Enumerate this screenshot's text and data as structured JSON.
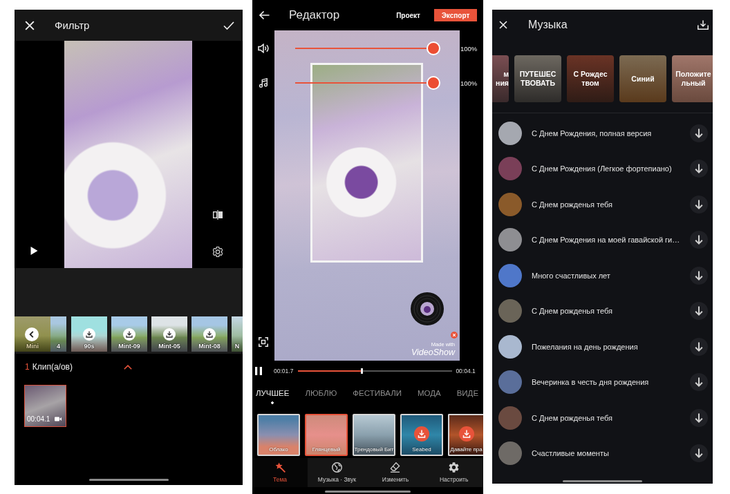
{
  "filter_screen": {
    "title": "Фильтр",
    "preview_playing": false,
    "filters": [
      {
        "label": "Mini",
        "selected": true,
        "downloadable": false
      },
      {
        "label": "4",
        "selected": false,
        "downloadable": false
      },
      {
        "label": "90s",
        "selected": false,
        "downloadable": true
      },
      {
        "label": "Mint-09",
        "selected": false,
        "downloadable": true
      },
      {
        "label": "Mint-05",
        "selected": false,
        "downloadable": true
      },
      {
        "label": "Mint-08",
        "selected": false,
        "downloadable": true
      },
      {
        "label": "N",
        "selected": false,
        "downloadable": false
      }
    ],
    "clip_count": "1",
    "clip_label": "Клип(а/ов)",
    "clips": [
      {
        "duration": "00:04.1",
        "selected": true
      }
    ]
  },
  "editor_screen": {
    "title": "Редактор",
    "project_label": "Проект",
    "export_label": "Экспорт",
    "volume_sliders": [
      {
        "kind": "sound",
        "level": 1,
        "reading": "100%"
      },
      {
        "kind": "music",
        "level": 1,
        "reading": "100%"
      }
    ],
    "watermark": {
      "caption": "Made with",
      "brand": "VideoShow"
    },
    "playback": {
      "playing": true,
      "current": "00:01.7",
      "level": 0.41,
      "total": "00:04.1"
    },
    "categories": [
      {
        "label": "ЛУЧШЕЕ",
        "selected": true
      },
      {
        "label": "ЛЮБЛЮ",
        "selected": false
      },
      {
        "label": "ФЕСТИВАЛИ",
        "selected": false
      },
      {
        "label": "МОДА",
        "selected": false
      },
      {
        "label": "ВИДЕ",
        "selected": false
      }
    ],
    "themes": [
      {
        "label": "Облако",
        "selected": false,
        "downloadable": false
      },
      {
        "label": "Глянцевый",
        "selected": true,
        "downloadable": false
      },
      {
        "label": "Трендовый Бит",
        "selected": false,
        "downloadable": false
      },
      {
        "label": "Seabed",
        "selected": false,
        "downloadable": true
      },
      {
        "label": "Давайте пра",
        "selected": false,
        "downloadable": true
      }
    ],
    "nav": [
      {
        "kind": "theme",
        "label": "Тема",
        "selected": true
      },
      {
        "kind": "music",
        "label": "Музыка · Звук",
        "selected": false
      },
      {
        "kind": "edit",
        "label": "Изменить",
        "selected": false
      },
      {
        "kind": "settings",
        "label": "Настроить",
        "selected": false
      }
    ]
  },
  "music_screen": {
    "title": "Музыка",
    "categories": [
      {
        "label": "м\nния"
      },
      {
        "label": "ПУТЕШЕС\nТВОВАТЬ"
      },
      {
        "label": "С Рождес\nтвом"
      },
      {
        "label": "Синий"
      },
      {
        "label": "Положите\nльный"
      }
    ],
    "tracks": [
      {
        "title": "С Днем Рождения, полная версия"
      },
      {
        "title": "С Днем Рождения (Легкое фортепиано)"
      },
      {
        "title": "С Днем рожденья тебя"
      },
      {
        "title": "С Днем Рождения на моей гавайской ги…"
      },
      {
        "title": "Много счастливых лет"
      },
      {
        "title": "С Днем рожденья тебя"
      },
      {
        "title": "Пожелания на день рождения"
      },
      {
        "title": "Вечеринка в честь дня рождения"
      },
      {
        "title": "С Днем рожденья тебя"
      },
      {
        "title": "Счастливые моменты"
      }
    ]
  }
}
